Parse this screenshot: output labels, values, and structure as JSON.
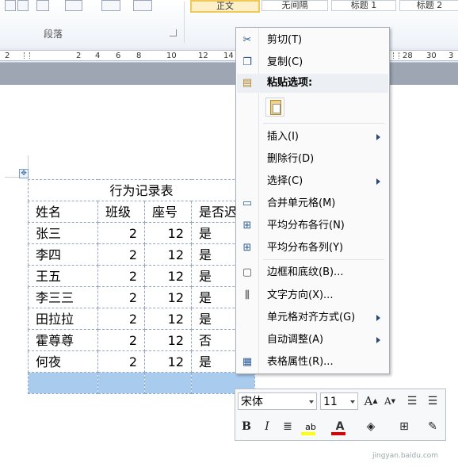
{
  "ribbon": {
    "group_label": "段落",
    "styles": [
      "正文",
      "无间隔",
      "标题 1",
      "标题 2"
    ]
  },
  "ruler": {
    "labels": [
      "2",
      "2",
      "4",
      "6",
      "8",
      "10",
      "12",
      "14",
      "28",
      "30",
      "3"
    ]
  },
  "table": {
    "title": "行为记录表",
    "headers": [
      "姓名",
      "班级",
      "座号",
      "是否迟"
    ],
    "rows": [
      [
        "张三",
        "2",
        "12",
        "是"
      ],
      [
        "李四",
        "2",
        "12",
        "是"
      ],
      [
        "王五",
        "2",
        "12",
        "是"
      ],
      [
        "李三三",
        "2",
        "12",
        "是"
      ],
      [
        "田拉拉",
        "2",
        "12",
        "是"
      ],
      [
        "霍尊尊",
        "2",
        "12",
        "否"
      ],
      [
        "何夜",
        "2",
        "12",
        "是"
      ]
    ]
  },
  "context_menu": {
    "cut": "剪切(T)",
    "copy": "复制(C)",
    "paste_options": "粘贴选项:",
    "insert": "插入(I)",
    "delete_row": "删除行(D)",
    "select": "选择(C)",
    "merge_cells": "合并单元格(M)",
    "distribute_rows": "平均分布各行(N)",
    "distribute_columns": "平均分布各列(Y)",
    "borders_shading": "边框和底纹(B)...",
    "text_direction": "文字方向(X)...",
    "cell_alignment": "单元格对齐方式(G)",
    "autofit": "自动调整(A)",
    "table_properties": "表格属性(R)..."
  },
  "mini_toolbar": {
    "font_name": "宋体",
    "font_size": "11",
    "bold": "B",
    "italic": "I",
    "grow_font": "A",
    "shrink_font": "A"
  },
  "colors": {
    "selection": "#a8cbee",
    "highlight_yellow": "#ffff00",
    "font_red": "#e00000",
    "menu_bg": "#fafafa"
  },
  "watermark": "jingyan.baidu.com"
}
